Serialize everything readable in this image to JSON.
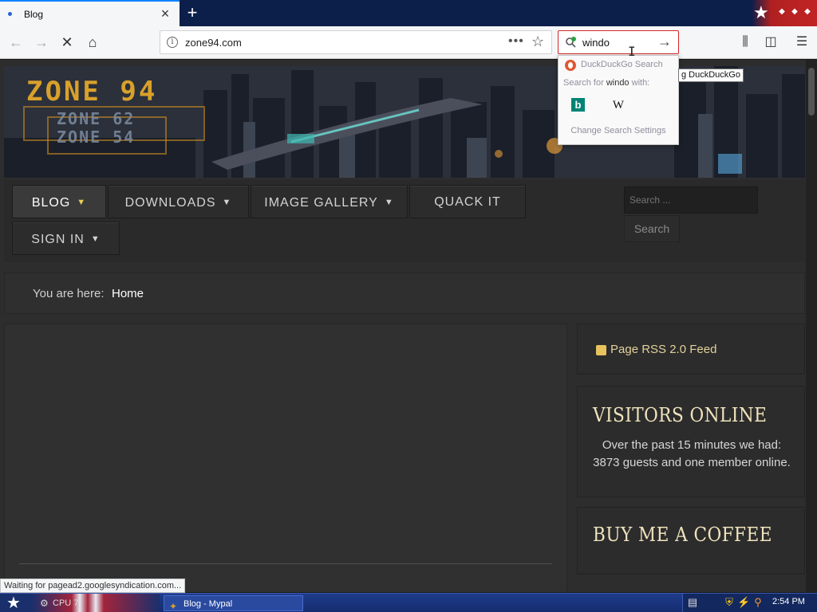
{
  "browser": {
    "tab_title": "Blog",
    "url": "zone94.com",
    "url_icon": "info-icon",
    "search_value": "windo",
    "search_dropdown": {
      "engine_label": "DuckDuckGo Search",
      "search_for_prefix": "Search for ",
      "search_for_term": "windo",
      "search_for_suffix": " with:",
      "engines": [
        "bing-icon",
        "wikipedia-icon"
      ],
      "wiki_glyph": "W",
      "bing_glyph": "b",
      "change_settings": "Change Search Settings"
    },
    "tooltip": "g DuckDuckGo"
  },
  "site": {
    "logo_main": "ZONE 94",
    "logo_sub1": "ZONE 62",
    "logo_sub2": "ZONE 54",
    "menu": [
      {
        "label": "BLOG",
        "has_caret": true,
        "active": true
      },
      {
        "label": "DOWNLOADS",
        "has_caret": true
      },
      {
        "label": "IMAGE GALLERY",
        "has_caret": true
      },
      {
        "label": "QUACK IT",
        "has_caret": false
      },
      {
        "label": "SIGN IN",
        "has_caret": true
      }
    ],
    "search_placeholder": "Search ...",
    "search_button": "Search",
    "breadcrumb_label": "You are here:",
    "breadcrumb_home": "Home",
    "rss_label": "Page RSS 2.0 Feed",
    "visitors_title": "VISITORS ONLINE",
    "visitors_text": "Over the past 15 minutes we had: 3873 guests and one member online.",
    "coffee_title": "BUY ME A COFFEE"
  },
  "status_text": "Waiting for pagead2.googlesyndication.com...",
  "taskbar": {
    "cpu_label": "CPU 7",
    "window_label": "Blog - Mypal",
    "clock": "2:54 PM"
  },
  "colors": {
    "accent": "#d9a02a",
    "heading": "#f0e3bd",
    "search_border": "#d7262a"
  }
}
